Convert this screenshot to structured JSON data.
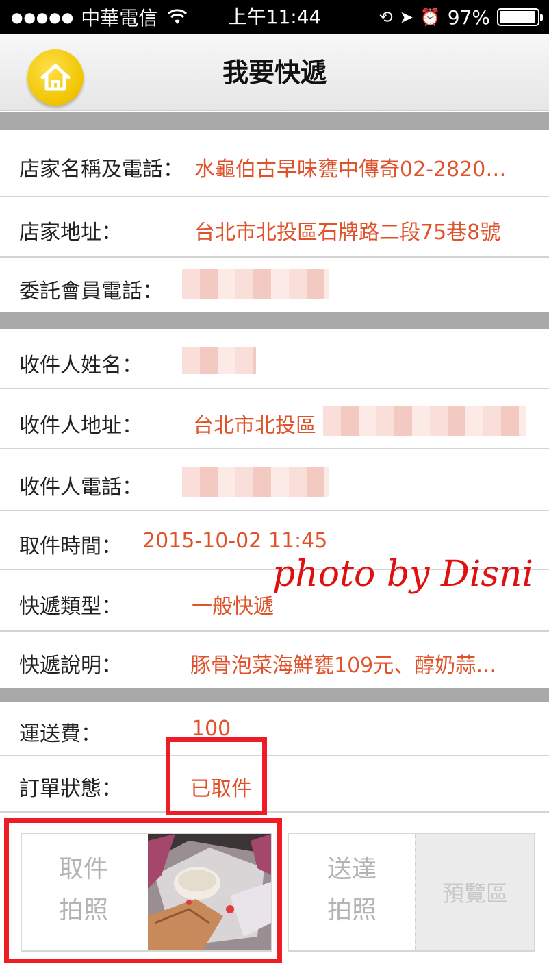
{
  "status_bar": {
    "signal": "●●●●●",
    "carrier": "中華電信",
    "time": "上午11:44",
    "battery_percent": "97%",
    "battery_level": 0.97
  },
  "nav": {
    "title": "我要快遞"
  },
  "shop": {
    "name_label": "店家名稱及電話：",
    "name_value": "水龜伯古早味甕中傳奇02-2820…",
    "address_label": "店家地址：",
    "address_value": "台北市北投區石牌路二段75巷8號",
    "member_phone_label": "委託會員電話："
  },
  "recipient": {
    "name_label": "收件人姓名：",
    "address_label": "收件人地址：",
    "address_value": "台北市北投區",
    "phone_label": "收件人電話："
  },
  "delivery": {
    "pickup_time_label": "取件時間：",
    "pickup_time_value": "2015-10-02 11:45",
    "type_label": "快遞類型：",
    "type_value": "一般快遞",
    "desc_label": "快遞說明：",
    "desc_value": "豚骨泡菜海鮮甕109元、醇奶蒜…"
  },
  "order": {
    "fee_label": "運送費：",
    "fee_value": "100",
    "status_label": "訂單狀態：",
    "status_value": "已取件"
  },
  "photos": {
    "pickup_label_line1": "取件",
    "pickup_label_line2": "拍照",
    "delivery_label_line1": "送達",
    "delivery_label_line2": "拍照",
    "preview_label": "預覽區"
  },
  "watermark": "photo by Disni",
  "colors": {
    "value_text": "#e0522a",
    "highlight": "#ee1c24",
    "separator": "#a9a9a9",
    "home_button": "#f0c400"
  }
}
